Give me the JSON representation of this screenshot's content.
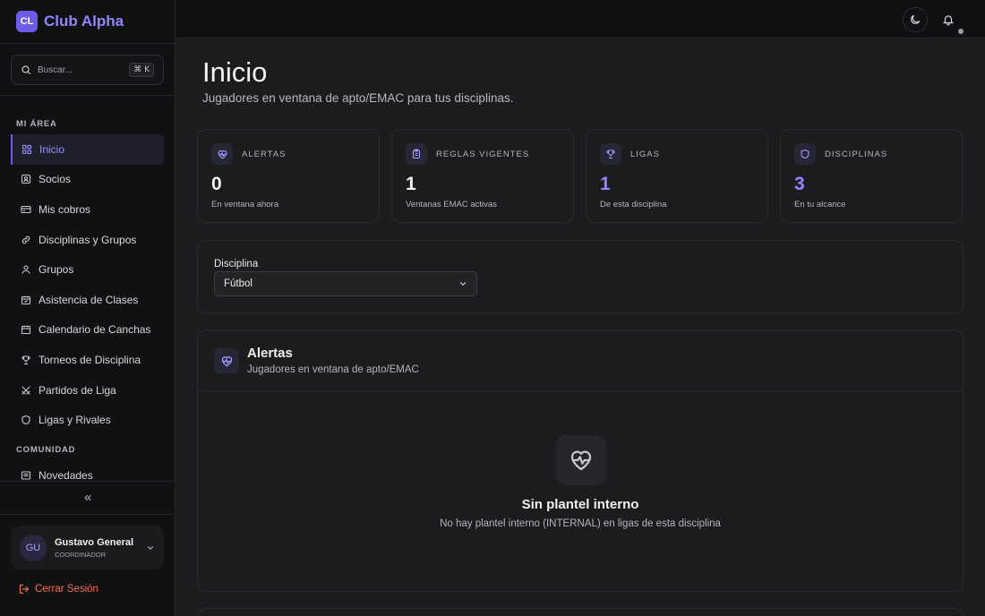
{
  "brand": {
    "logo": "CL",
    "name": "Club Alpha"
  },
  "search": {
    "placeholder": "Buscar...",
    "shortcut": "⌘ K"
  },
  "sidebar": {
    "sections": [
      {
        "label": "MI ÁREA"
      },
      {
        "label": "COMUNIDAD"
      }
    ],
    "items": [
      {
        "label": "Inicio",
        "icon": "grid-icon",
        "active": true
      },
      {
        "label": "Socios",
        "icon": "id-card-icon"
      },
      {
        "label": "Mis cobros",
        "icon": "wallet-icon"
      },
      {
        "label": "Disciplinas y Grupos",
        "icon": "link-icon"
      },
      {
        "label": "Grupos",
        "icon": "user-icon"
      },
      {
        "label": "Asistencia de Clases",
        "icon": "calendar-check-icon"
      },
      {
        "label": "Calendario de Canchas",
        "icon": "calendar-icon"
      },
      {
        "label": "Torneos de Disciplina",
        "icon": "trophy-icon"
      },
      {
        "label": "Partidos de Liga",
        "icon": "swords-icon"
      },
      {
        "label": "Ligas y Rivales",
        "icon": "shield-icon"
      },
      {
        "label": "Novedades",
        "icon": "newspaper-icon"
      }
    ],
    "collapse_icon": "chevrons-left-icon"
  },
  "user": {
    "initials": "GU",
    "name": "Gustavo General",
    "role": "COORDINADOR"
  },
  "logout": {
    "label": "Cerrar Sesión",
    "color": "#f0705a"
  },
  "topbar": {
    "theme_icon": "moon-icon",
    "bell_icon": "bell-icon"
  },
  "page": {
    "title": "Inicio",
    "subtitle": "Jugadores en ventana de apto/EMAC para tus disciplinas."
  },
  "stats": [
    {
      "label": "ALERTAS",
      "value": "0",
      "desc": "En ventana ahora",
      "icon": "heart-pulse-icon",
      "color": "#f2f2f4"
    },
    {
      "label": "REGLAS VIGENTES",
      "value": "1",
      "desc": "Ventanas EMAC activas",
      "icon": "clipboard-icon",
      "color": "#f2f2f4"
    },
    {
      "label": "LIGAS",
      "value": "1",
      "desc": "De esta disciplina",
      "icon": "trophy-icon",
      "color": "#8f87ff"
    },
    {
      "label": "DISCIPLINAS",
      "value": "3",
      "desc": "En tu alcance",
      "icon": "shield-icon",
      "color": "#8f87ff"
    }
  ],
  "filter": {
    "label": "Disciplina",
    "selected": "Fútbol"
  },
  "alerts": {
    "title": "Alertas",
    "subtitle": "Jugadores en ventana de apto/EMAC",
    "empty_title": "Sin plantel interno",
    "empty_text": "No hay plantel interno (INTERNAL) en ligas de esta disciplina"
  },
  "colors": {
    "accent": "#6d5ce8",
    "accent_text": "#8f87ff",
    "background": "#1c1c1e",
    "sidebar": "#111113"
  }
}
